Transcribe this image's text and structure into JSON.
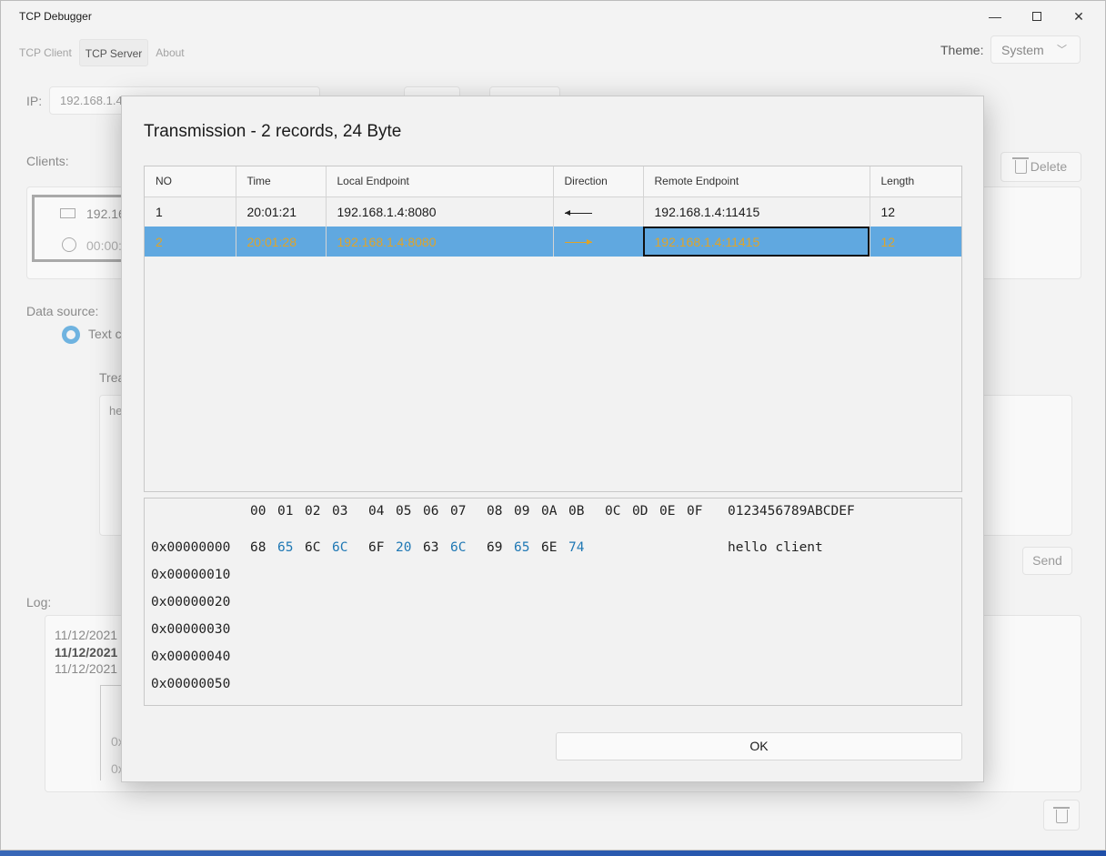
{
  "app": {
    "title": "TCP Debugger",
    "tabs": [
      "TCP Client",
      "TCP Server",
      "About"
    ],
    "theme_label": "Theme:",
    "theme_value": "System"
  },
  "background": {
    "ip_label": "IP:",
    "ip_value": "192.168.1.4",
    "clients_label": "Clients:",
    "client_endpoint": "192.16",
    "client_time": "00:00:5",
    "delete_label": "Delete",
    "data_source_label": "Data source:",
    "text_option": "Text c",
    "trea_label": "Trea",
    "text_area_value": "he",
    "send_label": "Send",
    "log_label": "Log:",
    "log_lines": [
      "11/12/2021",
      "11/12/2021 8",
      "11/12/2021"
    ],
    "log_hex_1": "0x",
    "log_hex_2": "0x"
  },
  "dialog": {
    "title": "Transmission - 2 records, 24 Byte",
    "columns": [
      "NO",
      "Time",
      "Local Endpoint",
      "Direction",
      "Remote Endpoint",
      "Length"
    ],
    "rows": [
      {
        "no": "1",
        "time": "20:01:21",
        "local": "192.168.1.4:8080",
        "direction": "receive",
        "remote": "192.168.1.4:11415",
        "length": "12"
      },
      {
        "no": "2",
        "time": "20:01:28",
        "local": "192.168.1.4:8080",
        "direction": "send",
        "remote": "192.168.1.4:11415",
        "length": "12"
      }
    ],
    "selected_row": 1,
    "hex_header": [
      "00",
      "01",
      "02",
      "03",
      "04",
      "05",
      "06",
      "07",
      "08",
      "09",
      "0A",
      "0B",
      "0C",
      "0D",
      "0E",
      "0F"
    ],
    "ascii_header": "0123456789ABCDEF",
    "offsets": [
      "0x00000000",
      "0x00000010",
      "0x00000020",
      "0x00000030",
      "0x00000040",
      "0x00000050"
    ],
    "first_line_bytes": [
      "68",
      "65",
      "6C",
      "6C",
      "6F",
      "20",
      "63",
      "6C",
      "69",
      "65",
      "6E",
      "74"
    ],
    "first_line_ascii": "hello client",
    "ok_label": "OK"
  },
  "colors": {
    "selection": "#60a8e0",
    "selected_text": "#e0a428",
    "hex_highlight": "#1f78b4"
  }
}
